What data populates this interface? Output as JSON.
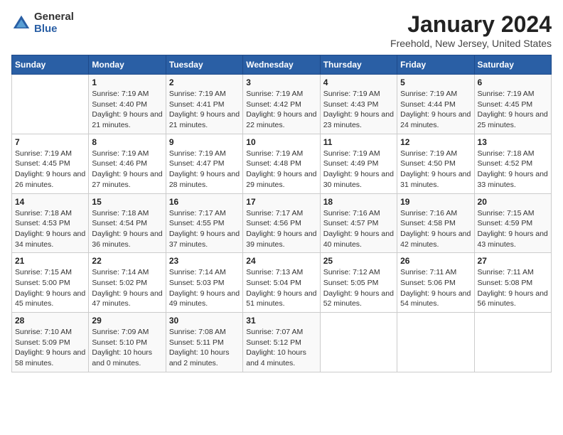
{
  "logo": {
    "general": "General",
    "blue": "Blue"
  },
  "title": "January 2024",
  "subtitle": "Freehold, New Jersey, United States",
  "weekdays": [
    "Sunday",
    "Monday",
    "Tuesday",
    "Wednesday",
    "Thursday",
    "Friday",
    "Saturday"
  ],
  "weeks": [
    [
      {
        "day": "",
        "sunrise": "",
        "sunset": "",
        "daylight": ""
      },
      {
        "day": "1",
        "sunrise": "Sunrise: 7:19 AM",
        "sunset": "Sunset: 4:40 PM",
        "daylight": "Daylight: 9 hours and 21 minutes."
      },
      {
        "day": "2",
        "sunrise": "Sunrise: 7:19 AM",
        "sunset": "Sunset: 4:41 PM",
        "daylight": "Daylight: 9 hours and 21 minutes."
      },
      {
        "day": "3",
        "sunrise": "Sunrise: 7:19 AM",
        "sunset": "Sunset: 4:42 PM",
        "daylight": "Daylight: 9 hours and 22 minutes."
      },
      {
        "day": "4",
        "sunrise": "Sunrise: 7:19 AM",
        "sunset": "Sunset: 4:43 PM",
        "daylight": "Daylight: 9 hours and 23 minutes."
      },
      {
        "day": "5",
        "sunrise": "Sunrise: 7:19 AM",
        "sunset": "Sunset: 4:44 PM",
        "daylight": "Daylight: 9 hours and 24 minutes."
      },
      {
        "day": "6",
        "sunrise": "Sunrise: 7:19 AM",
        "sunset": "Sunset: 4:45 PM",
        "daylight": "Daylight: 9 hours and 25 minutes."
      }
    ],
    [
      {
        "day": "7",
        "sunrise": "Sunrise: 7:19 AM",
        "sunset": "Sunset: 4:45 PM",
        "daylight": "Daylight: 9 hours and 26 minutes."
      },
      {
        "day": "8",
        "sunrise": "Sunrise: 7:19 AM",
        "sunset": "Sunset: 4:46 PM",
        "daylight": "Daylight: 9 hours and 27 minutes."
      },
      {
        "day": "9",
        "sunrise": "Sunrise: 7:19 AM",
        "sunset": "Sunset: 4:47 PM",
        "daylight": "Daylight: 9 hours and 28 minutes."
      },
      {
        "day": "10",
        "sunrise": "Sunrise: 7:19 AM",
        "sunset": "Sunset: 4:48 PM",
        "daylight": "Daylight: 9 hours and 29 minutes."
      },
      {
        "day": "11",
        "sunrise": "Sunrise: 7:19 AM",
        "sunset": "Sunset: 4:49 PM",
        "daylight": "Daylight: 9 hours and 30 minutes."
      },
      {
        "day": "12",
        "sunrise": "Sunrise: 7:19 AM",
        "sunset": "Sunset: 4:50 PM",
        "daylight": "Daylight: 9 hours and 31 minutes."
      },
      {
        "day": "13",
        "sunrise": "Sunrise: 7:18 AM",
        "sunset": "Sunset: 4:52 PM",
        "daylight": "Daylight: 9 hours and 33 minutes."
      }
    ],
    [
      {
        "day": "14",
        "sunrise": "Sunrise: 7:18 AM",
        "sunset": "Sunset: 4:53 PM",
        "daylight": "Daylight: 9 hours and 34 minutes."
      },
      {
        "day": "15",
        "sunrise": "Sunrise: 7:18 AM",
        "sunset": "Sunset: 4:54 PM",
        "daylight": "Daylight: 9 hours and 36 minutes."
      },
      {
        "day": "16",
        "sunrise": "Sunrise: 7:17 AM",
        "sunset": "Sunset: 4:55 PM",
        "daylight": "Daylight: 9 hours and 37 minutes."
      },
      {
        "day": "17",
        "sunrise": "Sunrise: 7:17 AM",
        "sunset": "Sunset: 4:56 PM",
        "daylight": "Daylight: 9 hours and 39 minutes."
      },
      {
        "day": "18",
        "sunrise": "Sunrise: 7:16 AM",
        "sunset": "Sunset: 4:57 PM",
        "daylight": "Daylight: 9 hours and 40 minutes."
      },
      {
        "day": "19",
        "sunrise": "Sunrise: 7:16 AM",
        "sunset": "Sunset: 4:58 PM",
        "daylight": "Daylight: 9 hours and 42 minutes."
      },
      {
        "day": "20",
        "sunrise": "Sunrise: 7:15 AM",
        "sunset": "Sunset: 4:59 PM",
        "daylight": "Daylight: 9 hours and 43 minutes."
      }
    ],
    [
      {
        "day": "21",
        "sunrise": "Sunrise: 7:15 AM",
        "sunset": "Sunset: 5:00 PM",
        "daylight": "Daylight: 9 hours and 45 minutes."
      },
      {
        "day": "22",
        "sunrise": "Sunrise: 7:14 AM",
        "sunset": "Sunset: 5:02 PM",
        "daylight": "Daylight: 9 hours and 47 minutes."
      },
      {
        "day": "23",
        "sunrise": "Sunrise: 7:14 AM",
        "sunset": "Sunset: 5:03 PM",
        "daylight": "Daylight: 9 hours and 49 minutes."
      },
      {
        "day": "24",
        "sunrise": "Sunrise: 7:13 AM",
        "sunset": "Sunset: 5:04 PM",
        "daylight": "Daylight: 9 hours and 51 minutes."
      },
      {
        "day": "25",
        "sunrise": "Sunrise: 7:12 AM",
        "sunset": "Sunset: 5:05 PM",
        "daylight": "Daylight: 9 hours and 52 minutes."
      },
      {
        "day": "26",
        "sunrise": "Sunrise: 7:11 AM",
        "sunset": "Sunset: 5:06 PM",
        "daylight": "Daylight: 9 hours and 54 minutes."
      },
      {
        "day": "27",
        "sunrise": "Sunrise: 7:11 AM",
        "sunset": "Sunset: 5:08 PM",
        "daylight": "Daylight: 9 hours and 56 minutes."
      }
    ],
    [
      {
        "day": "28",
        "sunrise": "Sunrise: 7:10 AM",
        "sunset": "Sunset: 5:09 PM",
        "daylight": "Daylight: 9 hours and 58 minutes."
      },
      {
        "day": "29",
        "sunrise": "Sunrise: 7:09 AM",
        "sunset": "Sunset: 5:10 PM",
        "daylight": "Daylight: 10 hours and 0 minutes."
      },
      {
        "day": "30",
        "sunrise": "Sunrise: 7:08 AM",
        "sunset": "Sunset: 5:11 PM",
        "daylight": "Daylight: 10 hours and 2 minutes."
      },
      {
        "day": "31",
        "sunrise": "Sunrise: 7:07 AM",
        "sunset": "Sunset: 5:12 PM",
        "daylight": "Daylight: 10 hours and 4 minutes."
      },
      {
        "day": "",
        "sunrise": "",
        "sunset": "",
        "daylight": ""
      },
      {
        "day": "",
        "sunrise": "",
        "sunset": "",
        "daylight": ""
      },
      {
        "day": "",
        "sunrise": "",
        "sunset": "",
        "daylight": ""
      }
    ]
  ]
}
